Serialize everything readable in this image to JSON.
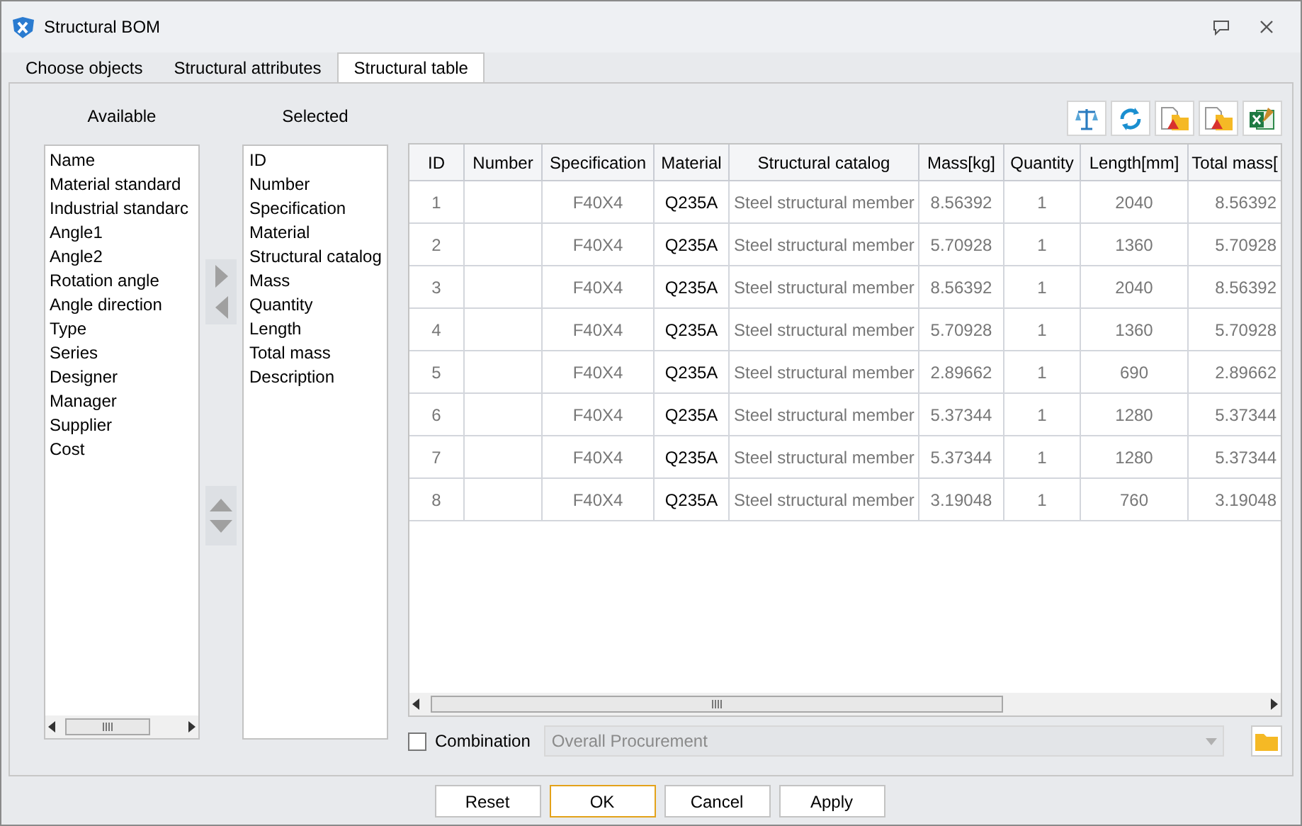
{
  "window": {
    "title": "Structural BOM"
  },
  "tabs": [
    {
      "label": "Choose objects",
      "selected": false
    },
    {
      "label": "Structural attributes",
      "selected": false
    },
    {
      "label": "Structural table",
      "selected": true
    }
  ],
  "available": {
    "heading": "Available",
    "items": [
      "Name",
      "Material standard",
      "Industrial standarc",
      "Angle1",
      "Angle2",
      "Rotation angle",
      "Angle direction",
      "Type",
      "Series",
      "Designer",
      "Manager",
      "Supplier",
      "Cost"
    ]
  },
  "selected_fields": {
    "heading": "Selected",
    "items": [
      "ID",
      "Number",
      "Specification",
      "Material",
      "Structural catalog",
      "Mass",
      "Quantity",
      "Length",
      "Total mass",
      "Description"
    ]
  },
  "table": {
    "columns": [
      "ID",
      "Number",
      "Specification",
      "Material",
      "Structural catalog",
      "Mass[kg]",
      "Quantity",
      "Length[mm]",
      "Total mass["
    ],
    "rows": [
      [
        "1",
        "",
        "F40X4",
        "Q235A",
        "Steel structural member",
        "8.56392",
        "1",
        "2040",
        "8.56392"
      ],
      [
        "2",
        "",
        "F40X4",
        "Q235A",
        "Steel structural member",
        "5.70928",
        "1",
        "1360",
        "5.70928"
      ],
      [
        "3",
        "",
        "F40X4",
        "Q235A",
        "Steel structural member",
        "8.56392",
        "1",
        "2040",
        "8.56392"
      ],
      [
        "4",
        "",
        "F40X4",
        "Q235A",
        "Steel structural member",
        "5.70928",
        "1",
        "1360",
        "5.70928"
      ],
      [
        "5",
        "",
        "F40X4",
        "Q235A",
        "Steel structural member",
        "2.89662",
        "1",
        "690",
        "2.89662"
      ],
      [
        "6",
        "",
        "F40X4",
        "Q235A",
        "Steel structural member",
        "5.37344",
        "1",
        "1280",
        "5.37344"
      ],
      [
        "7",
        "",
        "F40X4",
        "Q235A",
        "Steel structural member",
        "5.37344",
        "1",
        "1280",
        "5.37344"
      ],
      [
        "8",
        "",
        "F40X4",
        "Q235A",
        "Steel structural member",
        "3.19048",
        "1",
        "760",
        "3.19048"
      ]
    ]
  },
  "combination": {
    "label": "Combination",
    "checked": false,
    "value": "Overall Procurement",
    "disabled": true
  },
  "buttons": [
    {
      "label": "Reset",
      "focused": false
    },
    {
      "label": "OK",
      "focused": true
    },
    {
      "label": "Cancel",
      "focused": false
    },
    {
      "label": "Apply",
      "focused": false
    }
  ]
}
